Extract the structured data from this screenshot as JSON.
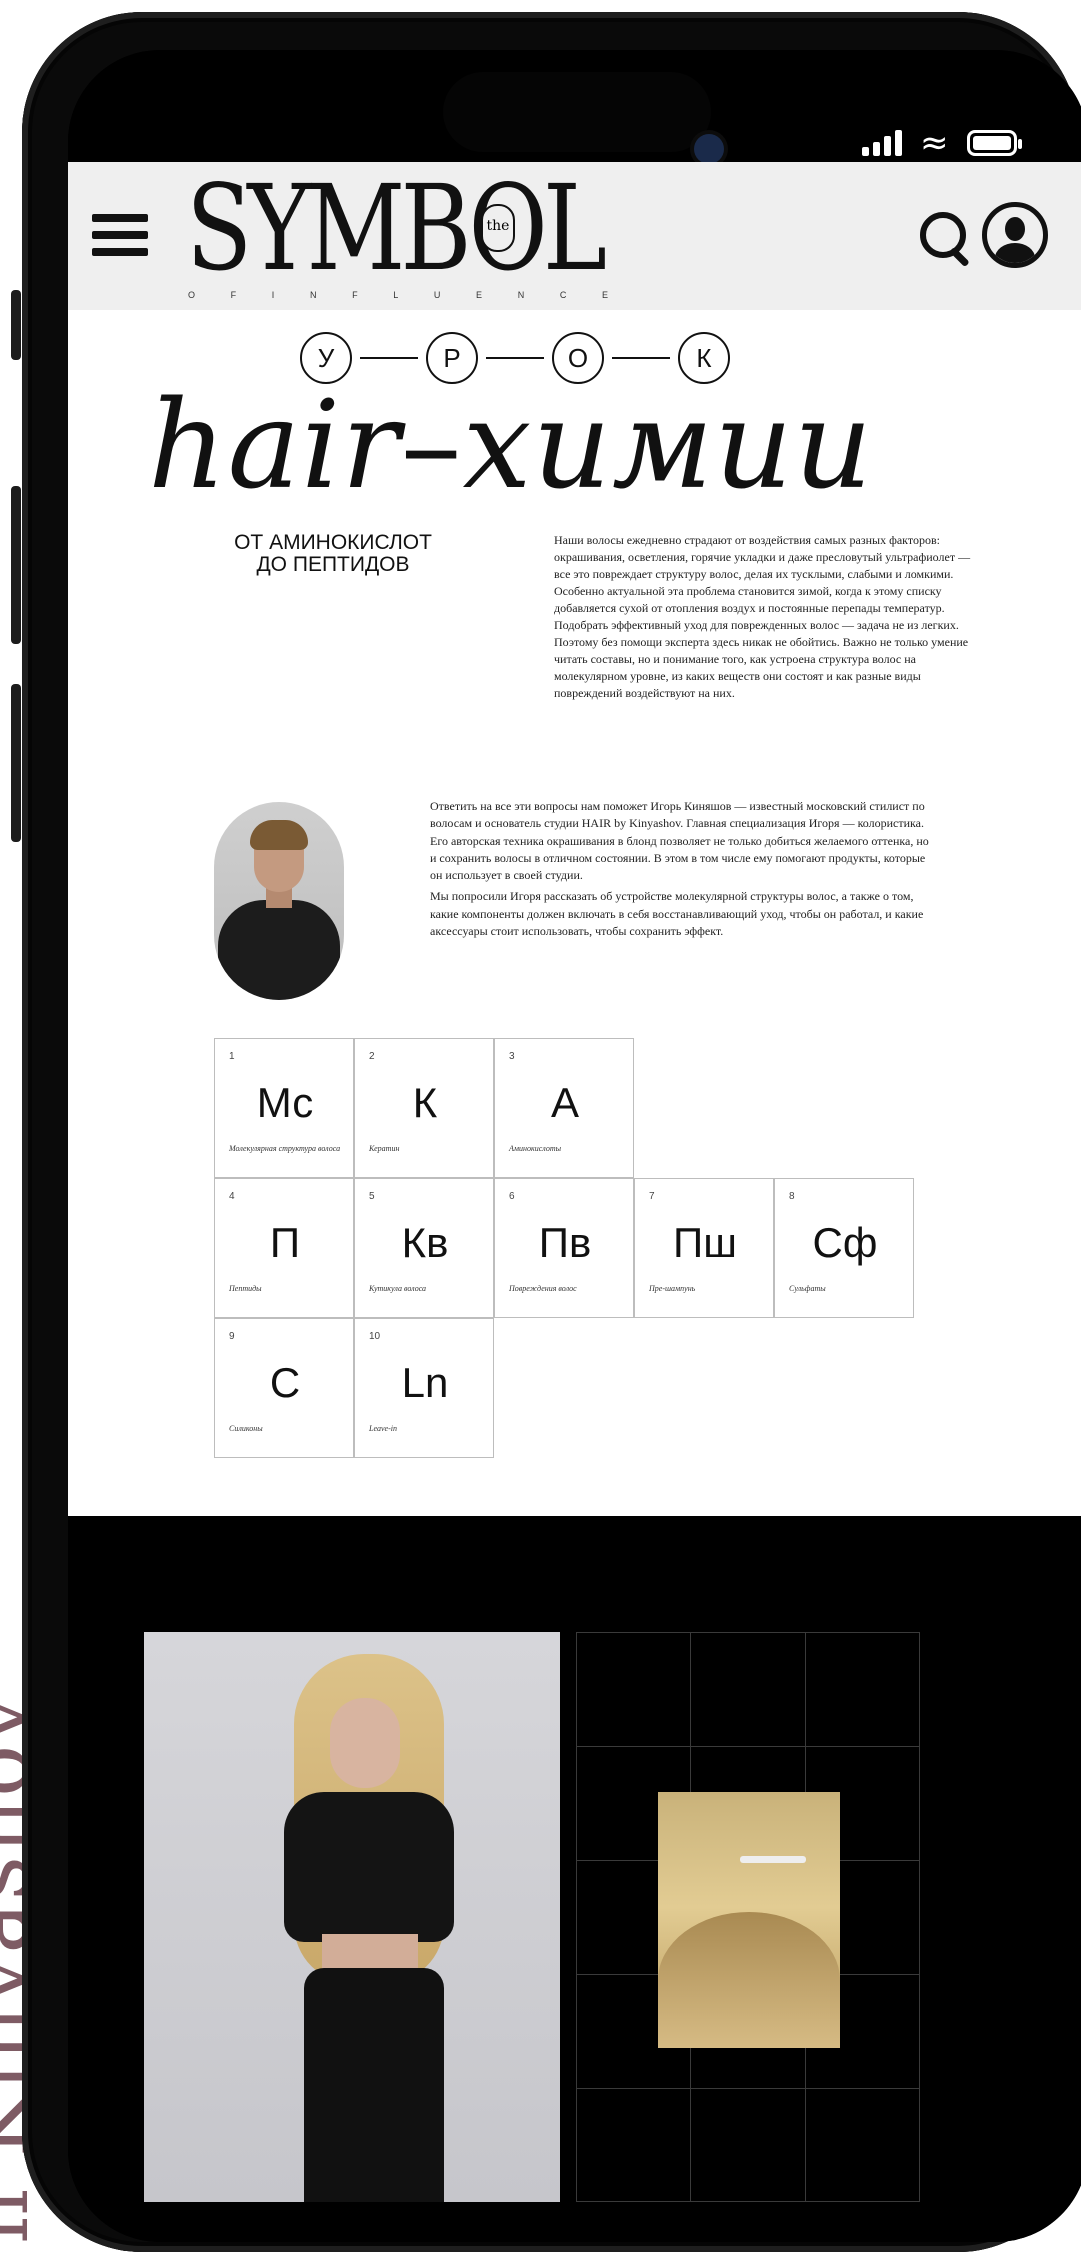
{
  "side_caption": "n Kinyashov",
  "status_bar": {
    "icons": [
      "signal-icon",
      "wifi-icon",
      "battery-icon"
    ]
  },
  "header": {
    "logo_main": "SYMBOL",
    "logo_the": "the",
    "logo_sub": [
      "O",
      "F",
      "I",
      "N",
      "F",
      "L",
      "U",
      "E",
      "N",
      "C",
      "E"
    ],
    "icons": [
      "menu-icon",
      "search-icon",
      "user-icon"
    ]
  },
  "hero": {
    "lesson_letters": [
      "У",
      "Р",
      "О",
      "К"
    ],
    "title_left": "hair",
    "title_dash": "–",
    "title_right": "химии",
    "subtitle_line1": "ОТ АМИНОКИСЛОТ",
    "subtitle_line2": "ДО ПЕПТИДОВ",
    "intro": "Наши волосы ежедневно страдают от воздействия самых разных факторов: окрашивания, осветления, горячие укладки и даже пресловутый ультрафиолет — все это повреждает структуру волос, делая их тусклыми, слабыми и ломкими. Особенно актуальной эта проблема становится зимой, когда к этому списку добавляется сухой от отопления воздух и постоянные перепады температур. Подобрать эффективный уход для поврежденных волос — задача не из легких. Поэтому без помощи эксперта здесь никак не обойтись. Важно не только умение читать составы, но и понимание того, как устроена структура волос на молекулярном уровне, из каких веществ они состоят и как разные виды повреждений воздействуют на них."
  },
  "expert": {
    "paragraph1": "Ответить на все эти вопросы нам поможет Игорь Киняшов — известный московский стилист по волосам и основатель студии HAIR by Kinyashov. Главная специализация Игоря — колористика. Его авторская техника окрашивания в блонд позволяет не только добиться желаемого оттенка, но и сохранить волосы в отличном состоянии. В этом в том числе ему помогают продукты, которые он использует в своей студии.",
    "paragraph2": "Мы попросили Игоря рассказать об устройстве молекулярной структуры волос, а также о том, какие компоненты должен включать в себя восстанавливающий уход, чтобы он работал, и какие аксессуары стоит использовать, чтобы сохранить эффект."
  },
  "elements": [
    {
      "num": "1",
      "symbol": "Мс",
      "name": "Молекулярная структура волоса"
    },
    {
      "num": "2",
      "symbol": "К",
      "name": "Кератин"
    },
    {
      "num": "3",
      "symbol": "А",
      "name": "Аминокислоты"
    },
    {
      "num": "4",
      "symbol": "П",
      "name": "Пептиды"
    },
    {
      "num": "5",
      "symbol": "Кв",
      "name": "Кутикула волоса"
    },
    {
      "num": "6",
      "symbol": "Пв",
      "name": "Повреждения волос"
    },
    {
      "num": "7",
      "symbol": "Пш",
      "name": "Пре-шампунь"
    },
    {
      "num": "8",
      "symbol": "Сф",
      "name": "Сульфаты"
    },
    {
      "num": "9",
      "symbol": "С",
      "name": "Силиконы"
    },
    {
      "num": "10",
      "symbol": "Ln",
      "name": "Leave-in"
    }
  ],
  "gallery": {
    "photo_left": "model-portrait-image",
    "photo_inner": "blonde-hair-comb-image"
  }
}
